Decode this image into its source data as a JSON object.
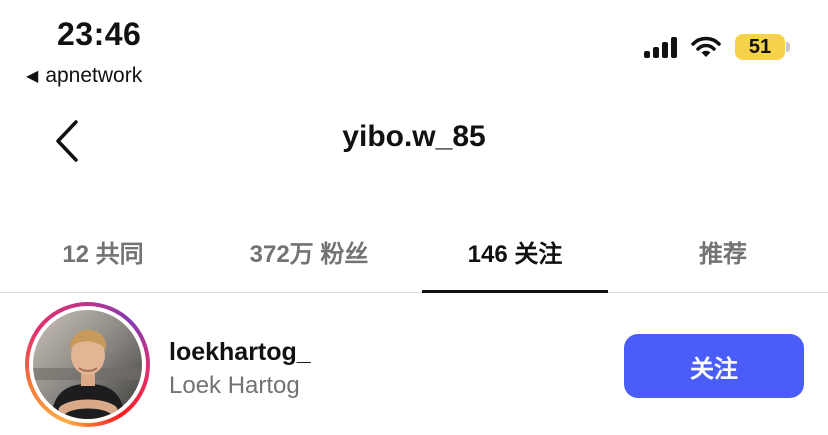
{
  "status_bar": {
    "time": "23:46",
    "back_app_label": "apnetwork",
    "battery_level": "51",
    "battery_color": "#f6d24a",
    "icons": [
      "back-triangle-icon",
      "cellular-signal-icon",
      "wifi-icon",
      "battery-icon"
    ]
  },
  "nav": {
    "title": "yibo.w_85",
    "back_icon": "chevron-left-icon"
  },
  "tabs": [
    {
      "label": "12 共同"
    },
    {
      "label": "372万 粉丝"
    },
    {
      "label": "146 关注",
      "active": true
    },
    {
      "label": "推荐"
    }
  ],
  "user_row": {
    "username": "loekhartog_",
    "full_name": "Loek Hartog",
    "follow_label": "关注",
    "follow_color": "#4a5df9",
    "has_story_ring": true
  }
}
